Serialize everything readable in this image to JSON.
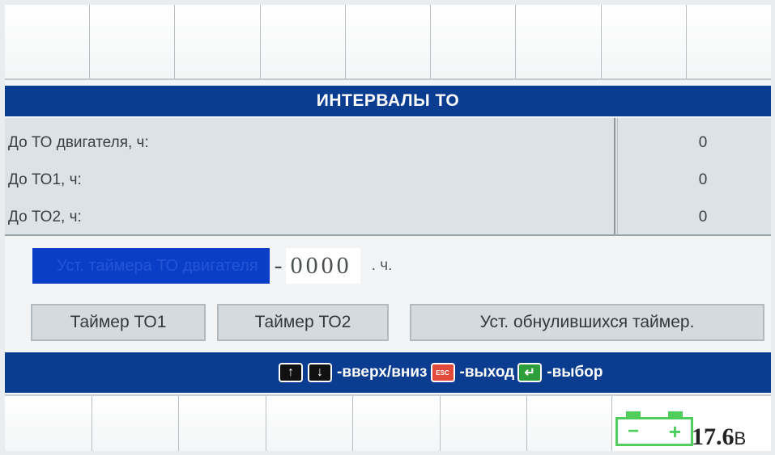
{
  "title": "ИНТЕРВАЛЫ ТО",
  "intervals": [
    {
      "label": "До ТО двигателя, ч:",
      "value": "0"
    },
    {
      "label": "До ТО1, ч:",
      "value": "0"
    },
    {
      "label": "До ТО2, ч:",
      "value": "0"
    }
  ],
  "timer_setting": {
    "label": "Уст. таймера ТО двигателя",
    "sign": "-",
    "digits": "0000",
    "unit": ". ч."
  },
  "buttons": {
    "timer1": "Таймер ТО1",
    "timer2": "Таймер ТО2",
    "reset_timers": "Уст. обнулившихся таймер."
  },
  "help": {
    "up_icon": "arrow-up-icon",
    "down_icon": "arrow-down-icon",
    "updown_text": "-вверх/вниз",
    "esc_key_label": "ESC",
    "esc_text": "-выход",
    "enter_text": "-выбор"
  },
  "battery": {
    "minus": "−",
    "plus": "+",
    "voltage": "17.6",
    "unit": "В"
  },
  "colors": {
    "header_blue": "#0a3c8f",
    "highlight_blue": "#0a3ec6",
    "battery_green": "#4fce5b",
    "esc_red": "#e24a3a",
    "enter_green": "#2e9e3a"
  }
}
